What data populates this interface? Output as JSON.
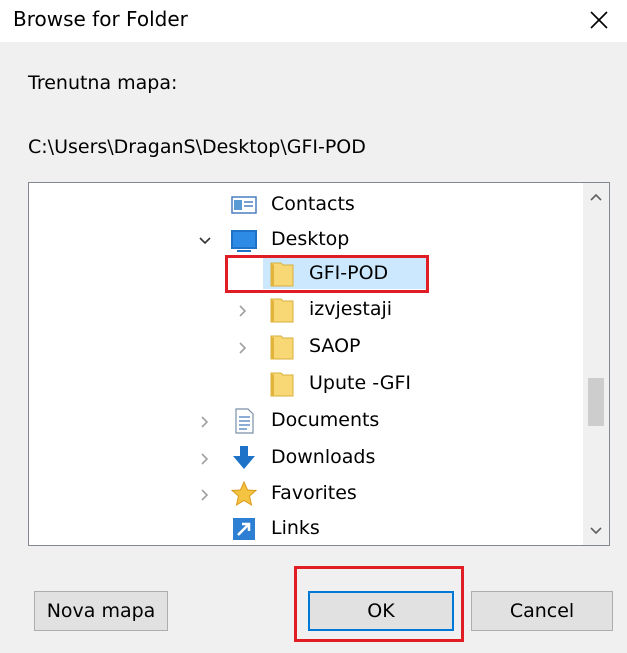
{
  "dialog": {
    "title": "Browse for Folder",
    "current_folder_label": "Trenutna mapa:",
    "current_path": "C:\\Users\\DraganS\\Desktop\\GFI-POD"
  },
  "tree": {
    "items": [
      {
        "label": "Contacts",
        "icon": "contacts-icon",
        "expander": "none"
      },
      {
        "label": "Desktop",
        "icon": "desktop-icon",
        "expander": "expanded"
      },
      {
        "label": "GFI-POD",
        "icon": "folder-icon",
        "expander": "none",
        "selected": true
      },
      {
        "label": "izvjestaji",
        "icon": "folder-icon",
        "expander": "collapsed"
      },
      {
        "label": "SAOP",
        "icon": "folder-icon",
        "expander": "collapsed"
      },
      {
        "label": "Upute -GFI",
        "icon": "folder-icon",
        "expander": "none"
      },
      {
        "label": "Documents",
        "icon": "documents-icon",
        "expander": "collapsed"
      },
      {
        "label": "Downloads",
        "icon": "downloads-icon",
        "expander": "collapsed"
      },
      {
        "label": "Favorites",
        "icon": "favorites-icon",
        "expander": "collapsed"
      },
      {
        "label": "Links",
        "icon": "links-icon",
        "expander": "none"
      }
    ]
  },
  "buttons": {
    "new_folder": "Nova mapa",
    "ok": "OK",
    "cancel": "Cancel"
  },
  "colors": {
    "selection": "#cce8ff",
    "annotation_red": "#e01c24",
    "focus_blue": "#0078d7",
    "folder_yellow": "#f8d775"
  }
}
